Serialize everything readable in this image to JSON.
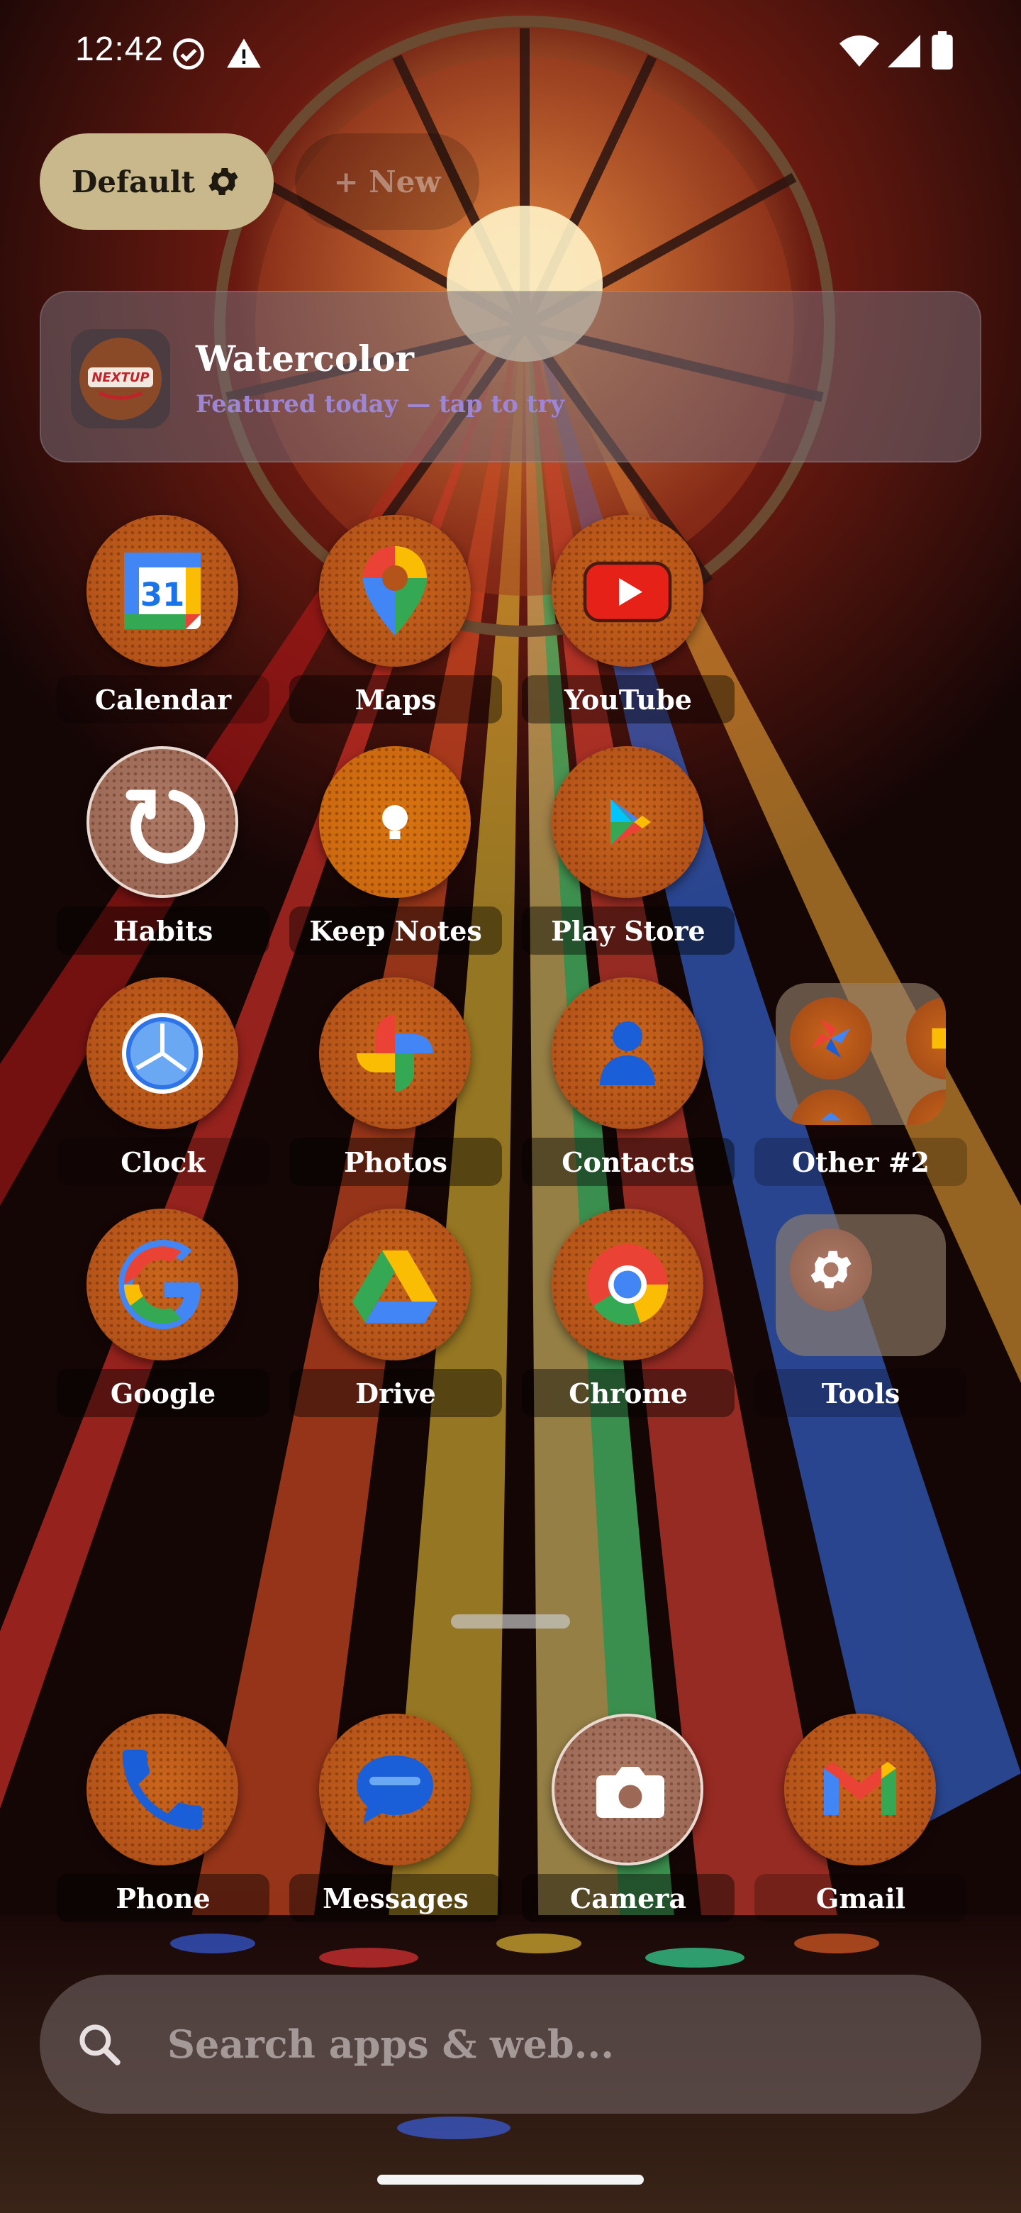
{
  "status_bar": {
    "time": "12:42"
  },
  "profiles": {
    "active": "Default",
    "new": "+ New"
  },
  "featured": {
    "logo_text": "NEXTUP",
    "title": "Watercolor",
    "subtitle": "Featured today — tap to try"
  },
  "apps": [
    {
      "label": "Calendar",
      "icon": "calendar-icon"
    },
    {
      "label": "Maps",
      "icon": "maps-icon"
    },
    {
      "label": "YouTube",
      "icon": "youtube-icon"
    },
    {
      "label": "Habits",
      "icon": "habits-icon"
    },
    {
      "label": "Keep Notes",
      "icon": "keep-notes-icon"
    },
    {
      "label": "Play Store",
      "icon": "play-store-icon"
    },
    {
      "label": "Clock",
      "icon": "clock-icon"
    },
    {
      "label": "Photos",
      "icon": "photos-icon"
    },
    {
      "label": "Contacts",
      "icon": "contacts-icon"
    },
    {
      "label": "Other #2",
      "icon": "folder-icon"
    },
    {
      "label": "Google",
      "icon": "google-icon"
    },
    {
      "label": "Drive",
      "icon": "drive-icon"
    },
    {
      "label": "Chrome",
      "icon": "chrome-icon"
    },
    {
      "label": "Tools",
      "icon": "folder-icon"
    }
  ],
  "calendar_day": "31",
  "dock": [
    {
      "label": "Phone",
      "icon": "phone-icon"
    },
    {
      "label": "Messages",
      "icon": "messages-icon"
    },
    {
      "label": "Camera",
      "icon": "camera-icon"
    },
    {
      "label": "Gmail",
      "icon": "gmail-icon"
    }
  ],
  "search": {
    "placeholder": "Search apps & web..."
  },
  "colors": {
    "profile_chip": "#c8b88c",
    "accent_subtitle": "#9d86d6",
    "icon_orange": "#c9651b"
  }
}
